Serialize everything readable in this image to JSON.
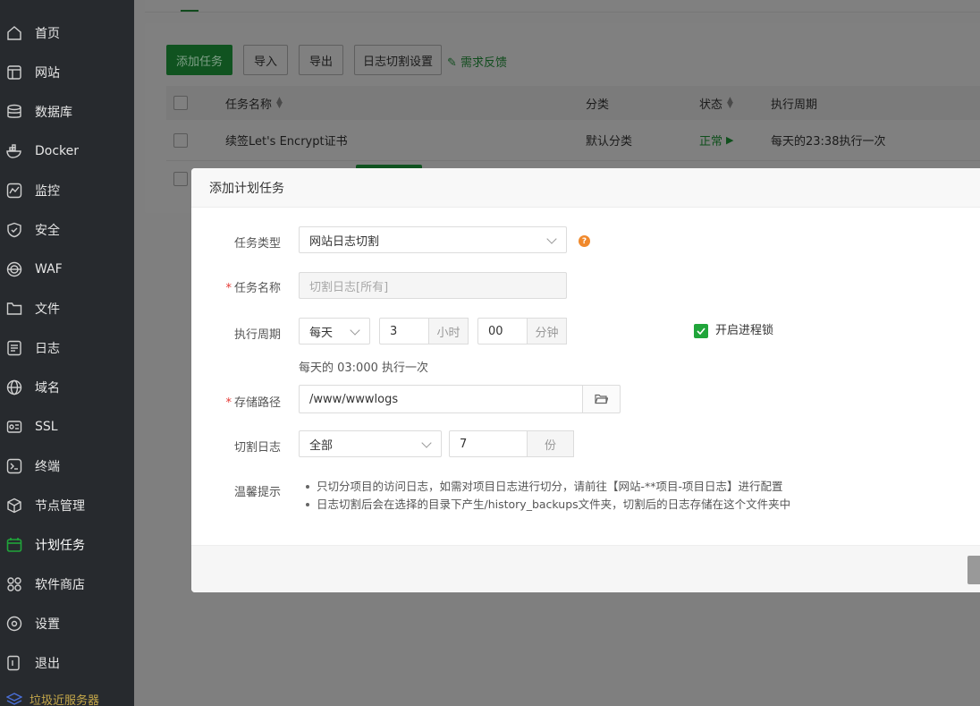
{
  "sidebar": {
    "items": [
      {
        "label": "首页",
        "icon": "home-icon"
      },
      {
        "label": "网站",
        "icon": "website-icon"
      },
      {
        "label": "数据库",
        "icon": "database-icon"
      },
      {
        "label": "Docker",
        "icon": "docker-icon"
      },
      {
        "label": "监控",
        "icon": "monitor-icon"
      },
      {
        "label": "安全",
        "icon": "shield-icon"
      },
      {
        "label": "WAF",
        "icon": "waf-icon"
      },
      {
        "label": "文件",
        "icon": "folder-icon"
      },
      {
        "label": "日志",
        "icon": "log-icon"
      },
      {
        "label": "域名",
        "icon": "globe-icon"
      },
      {
        "label": "SSL",
        "icon": "ssl-icon"
      },
      {
        "label": "终端",
        "icon": "terminal-icon"
      },
      {
        "label": "节点管理",
        "icon": "node-icon"
      },
      {
        "label": "计划任务",
        "icon": "calendar-icon",
        "active": true
      },
      {
        "label": "软件商店",
        "icon": "apps-icon"
      },
      {
        "label": "设置",
        "icon": "gear-icon"
      },
      {
        "label": "退出",
        "icon": "logout-icon"
      }
    ],
    "bottom_label": "垃圾近服务器"
  },
  "toolbar": {
    "add_task": "添加任务",
    "import": "导入",
    "export": "导出",
    "log_cut_settings": "日志切割设置",
    "feedback": "需求反馈"
  },
  "table": {
    "headers": {
      "name": "任务名称",
      "category": "分类",
      "status": "状态",
      "cycle": "执行周期"
    },
    "rows": [
      {
        "name": "续签Let's Encrypt证书",
        "category": "默认分类",
        "status": "正常",
        "cycle": "每天的23:38执行一次"
      }
    ]
  },
  "modal": {
    "title": "添加计划任务",
    "task_type_label": "任务类型",
    "task_type_value": "网站日志切割",
    "help_mark": "?",
    "task_name_label": "任务名称",
    "task_name_value": "切割日志[所有]",
    "cycle_label": "执行周期",
    "cycle_period": "每天",
    "hour_value": "3",
    "hour_unit": "小时",
    "minute_value": "00",
    "minute_unit": "分钟",
    "lock_label": "开启进程锁",
    "lock_checked": true,
    "cycle_hint": "每天的 03:000 执行一次",
    "path_label": "存储路径",
    "path_value": "/www/wwwlogs",
    "cut_log_label": "切割日志",
    "cut_log_value": "全部",
    "keep_value": "7",
    "keep_unit": "份",
    "tips_label": "温馨提示",
    "tips": [
      "只切分项目的访问日志，如需对项目日志进行切分，请前往【网站-**项目-项目日志】进行配置",
      "日志切割后会在选择的目录下产生/history_backups文件夹，切割后的日志存储在这个文件夹中"
    ]
  },
  "colors": {
    "accent": "#20a53a",
    "sidebar_bg": "#272a2e",
    "help_orange": "#f0892c",
    "required": "#e53935"
  }
}
